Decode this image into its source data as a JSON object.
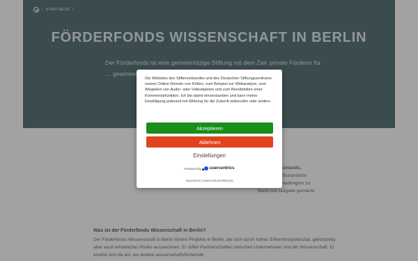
{
  "breadcrumb": {
    "separator": "/",
    "current": "STARTSEITE"
  },
  "hero": {
    "title": "FÖRDERFONDS WISSENSCHAFT IN BERLIN",
    "text": "Der Förderfonds ist eine gemeinnützige Stiftung mit dem Ziel, private Förderer für … gewinnen und d… n."
  },
  "content": {
    "intro_bold": "onen Deutschlands,",
    "intro_lines": [
      "Wissenschaftsstandorte",
      "d die Hauptstadtregion zu",
      "Berlin zur Aufgabe gemacht."
    ],
    "question": "Was ist der Förderfonds Wissenschaft in Berlin?",
    "body": "Der Förderfonds Wissenschaft in Berlin fördert Projekte in Berlin, die sich durch hohes Erkenntnispotenzial, gleichzeitig aber auch erhebliches Risiko auszeichnen. Er stiftet Partnerschaften zwischen Unternehmen und der Wissenschaft. Er ersetzt sich da ein, wo andere wissenschaftsfördernde"
  },
  "consent": {
    "text": "Die Websites des Stifterverbandes und des Deutschen Stiftungszentrums nutzen Online-Dienste von Dritten, zum Beispiel zur Webanalyse, zum Abspielen von Audio- oder Videodateien und zum Bereitstellen einer Kommentarfunktion. Ich bin damit einverstanden und kann meine Einwilligung jederzeit mit Wirkung für die Zukunft widerrufen oder ändern.",
    "accept_label": "Akzeptieren",
    "deny_label": "Ablehnen",
    "settings_label": "Einstellungen",
    "powered_by": "Powered by",
    "brand": "usercentrics",
    "impressum": "Impressum",
    "link_separator": "|",
    "privacy": "Datenschutzerklärung"
  },
  "colors": {
    "accept": "#1a8e1a",
    "deny": "#e0441e",
    "hero_bg": "#1d3f44"
  }
}
